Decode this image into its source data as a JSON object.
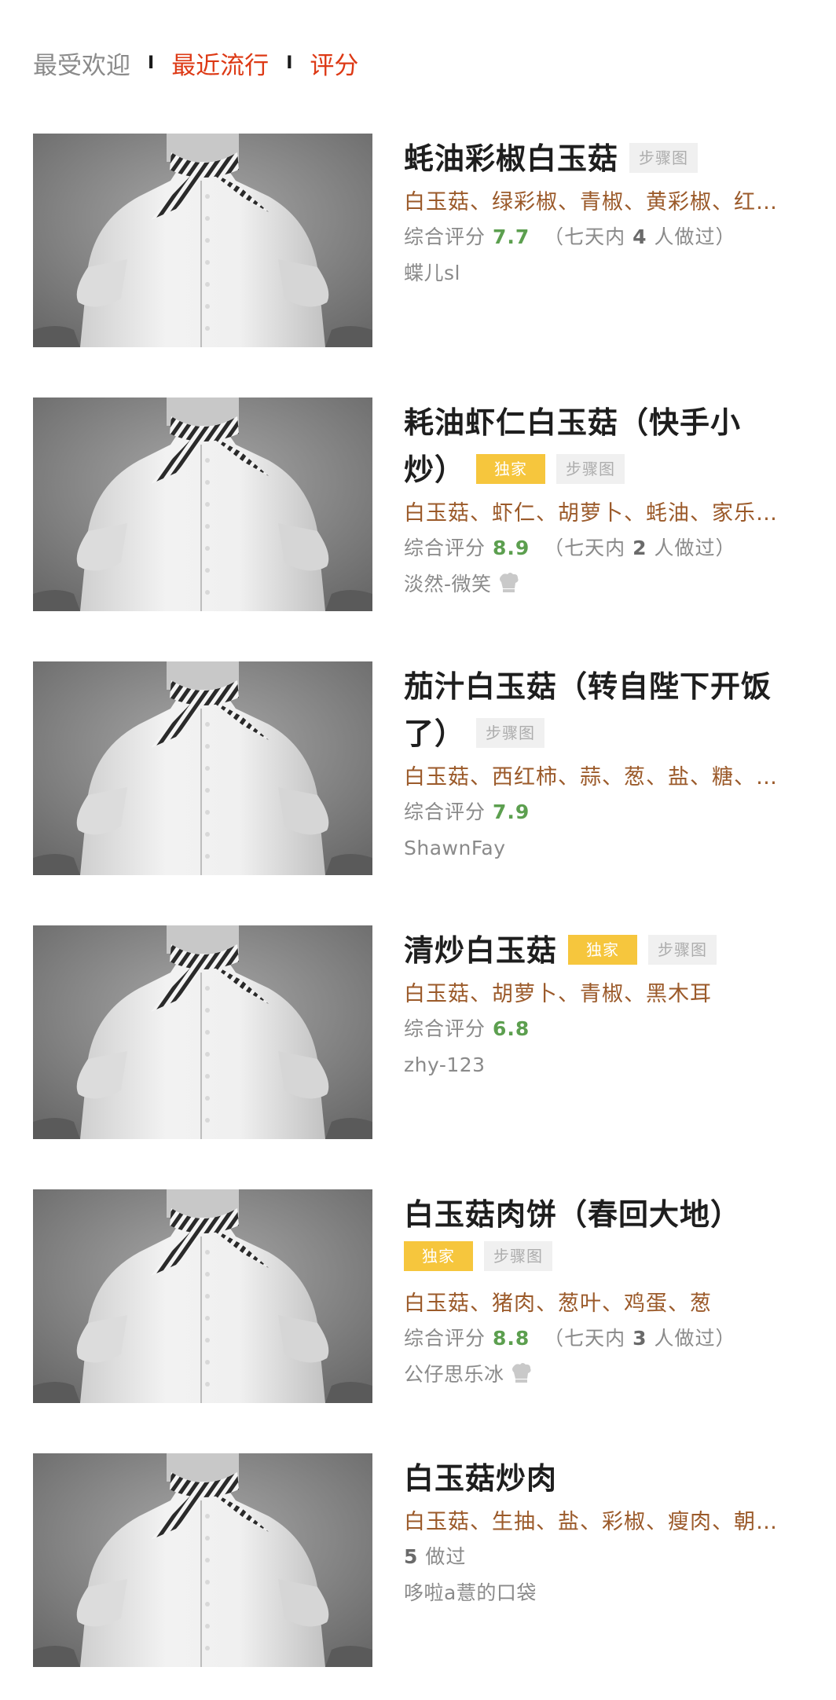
{
  "tabs": [
    {
      "label": "最受欢迎",
      "active": false
    },
    {
      "label": "最近流行",
      "active": true
    },
    {
      "label": "评分",
      "active": true
    }
  ],
  "tab_separator": "I",
  "labels": {
    "steps_badge": "步骤图",
    "exclusive_badge": "独家",
    "rating_prefix": "综合评分",
    "week_prefix": "（七天内",
    "week_suffix": "人做过）",
    "made_suffix": "做过"
  },
  "recipes": [
    {
      "title_lines": [
        "蚝油彩椒白玉菇"
      ],
      "ingredients": "白玉菇、绿彩椒、青椒、黄彩椒、红…",
      "score": "7.7",
      "week_count": "4",
      "author": "蝶儿sl"
    },
    {
      "title_lines": [
        "耗油虾仁白玉菇（快手小",
        "炒）"
      ],
      "ingredients": "白玉菇、虾仁、胡萝卜、蚝油、家乐…",
      "score": "8.9",
      "week_count": "2",
      "author": "淡然-微笑"
    },
    {
      "title_lines": [
        "茄汁白玉菇（转自陛下开饭",
        "了）"
      ],
      "ingredients": "白玉菇、西红柿、蒜、葱、盐、糖、…",
      "score": "7.9",
      "author": "ShawnFay"
    },
    {
      "title_lines": [
        "清炒白玉菇"
      ],
      "ingredients": "白玉菇、胡萝卜、青椒、黑木耳",
      "score": "6.8",
      "author": "zhy-123"
    },
    {
      "title_lines": [
        "白玉菇肉饼（春回大地）"
      ],
      "ingredients": "白玉菇、猪肉、葱叶、鸡蛋、葱",
      "score": "8.8",
      "week_count": "3",
      "author": "公仔思乐冰"
    },
    {
      "title_lines": [
        "白玉菇炒肉"
      ],
      "ingredients": "白玉菇、生抽、盐、彩椒、瘦肉、朝…",
      "made_count": "5",
      "author": "哆啦a薏的口袋"
    }
  ],
  "colors": {
    "tab_active": "#dd3915",
    "tab_inactive": "#8a8a8a",
    "ingredients": "#9b5a2a",
    "score": "#5c9f4f",
    "exclusive_badge_bg": "#f6c63d",
    "steps_badge_bg": "#f0f0f0"
  }
}
